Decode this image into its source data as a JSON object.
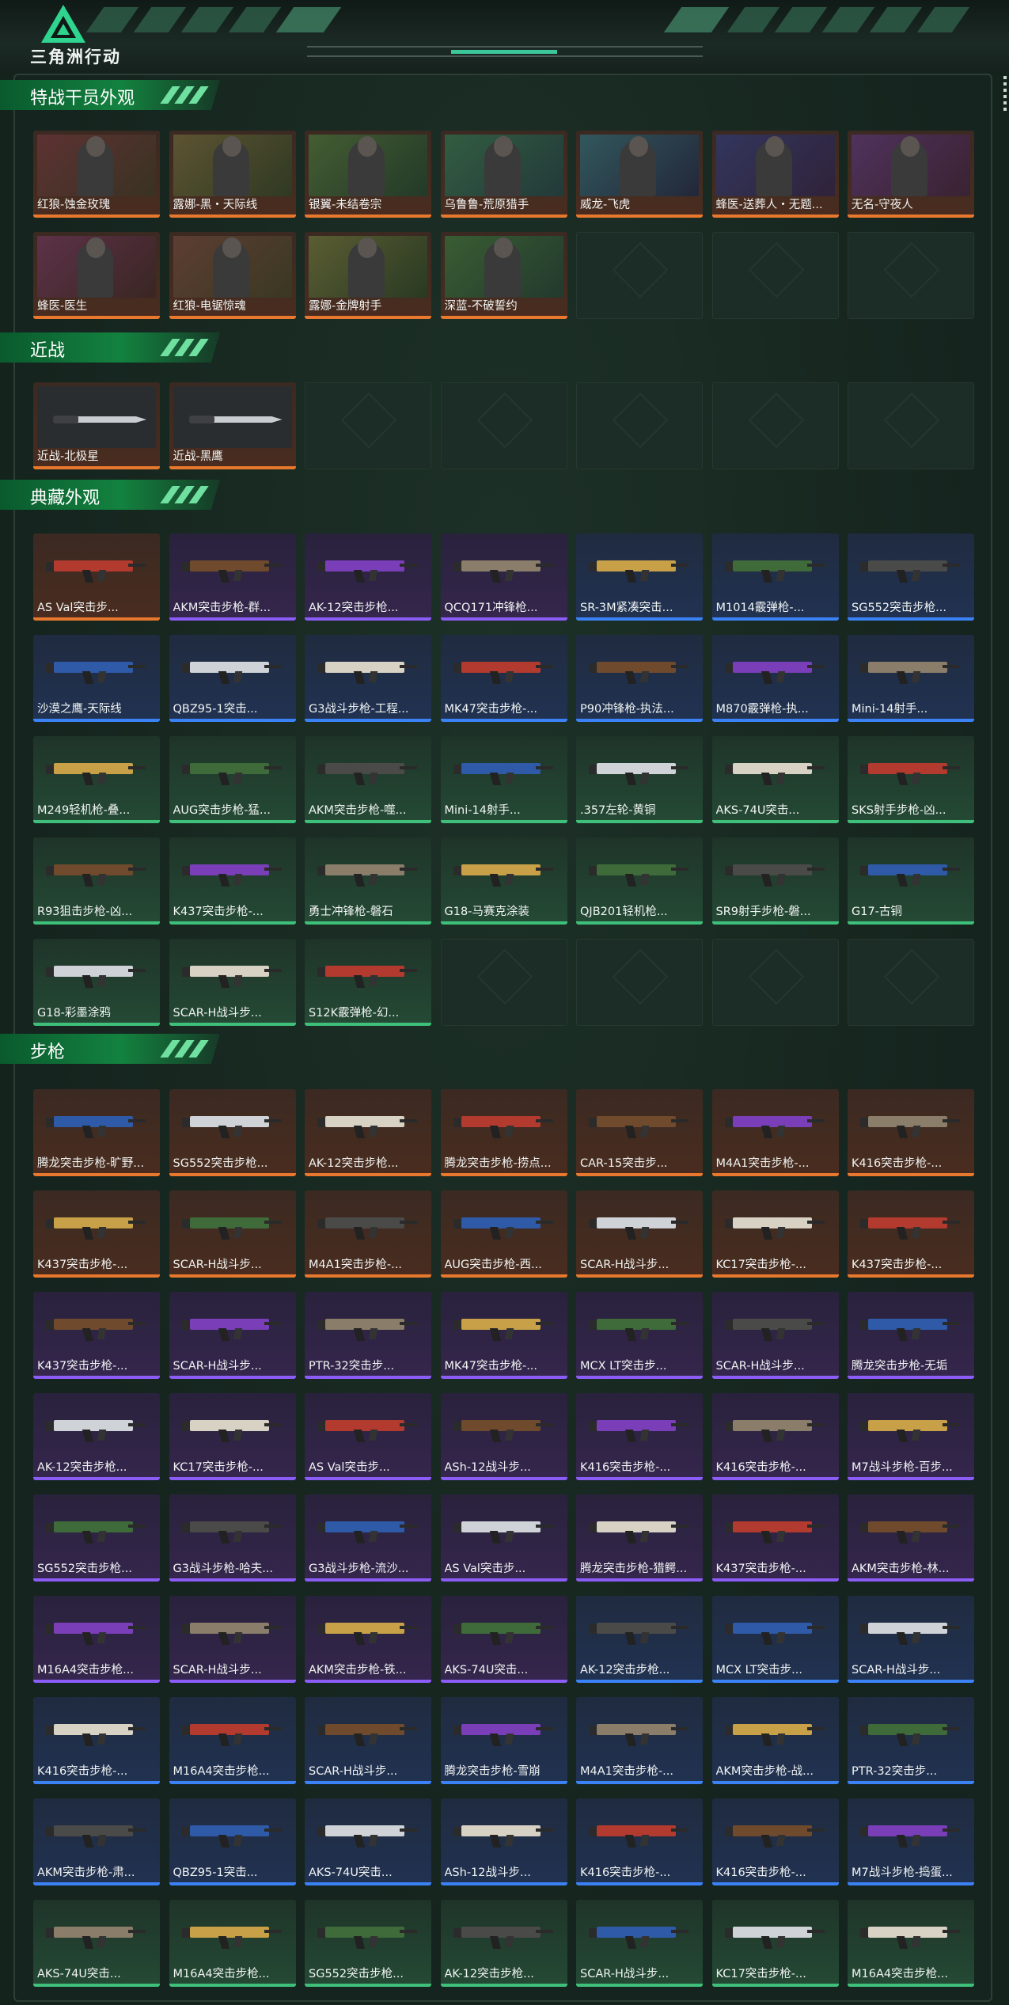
{
  "header": {
    "logo_text": "三角洲行动"
  },
  "sections": [
    {
      "title": "特战干员外观",
      "kind": "operator",
      "rows": 2,
      "items": [
        {
          "label": "红狼-蚀金玫瑰",
          "rarity": "orange"
        },
        {
          "label": "露娜-黑・天际线",
          "rarity": "orange"
        },
        {
          "label": "银翼-未结卷宗",
          "rarity": "orange"
        },
        {
          "label": "乌鲁鲁-荒原猎手",
          "rarity": "orange"
        },
        {
          "label": "威龙-飞虎",
          "rarity": "orange"
        },
        {
          "label": "蜂医-送葬人・无题...",
          "rarity": "orange"
        },
        {
          "label": "无名-守夜人",
          "rarity": "orange"
        },
        {
          "label": "蜂医-医生",
          "rarity": "orange"
        },
        {
          "label": "红狼-电锯惊魂",
          "rarity": "orange"
        },
        {
          "label": "露娜-金牌射手",
          "rarity": "orange"
        },
        {
          "label": "深蓝-不破誓约",
          "rarity": "orange"
        }
      ]
    },
    {
      "title": "近战",
      "kind": "melee",
      "rows": 1,
      "items": [
        {
          "label": "近战-北极星",
          "rarity": "orange"
        },
        {
          "label": "近战-黑鹰",
          "rarity": "orange"
        }
      ]
    },
    {
      "title": "典藏外观",
      "kind": "weapon",
      "rows": 5,
      "items": [
        {
          "label": "AS Val突击步...",
          "rarity": "orange"
        },
        {
          "label": "AKM突击步枪-群...",
          "rarity": "purple"
        },
        {
          "label": "AK-12突击步枪...",
          "rarity": "purple"
        },
        {
          "label": "QCQ171冲锋枪...",
          "rarity": "purple"
        },
        {
          "label": "SR-3M紧凑突击...",
          "rarity": "blue"
        },
        {
          "label": "M1014霰弹枪-...",
          "rarity": "blue"
        },
        {
          "label": "SG552突击步枪...",
          "rarity": "blue"
        },
        {
          "label": "沙漠之鹰-天际线",
          "rarity": "blue"
        },
        {
          "label": "QBZ95-1突击...",
          "rarity": "blue"
        },
        {
          "label": "G3战斗步枪-工程...",
          "rarity": "blue"
        },
        {
          "label": "MK47突击步枪-...",
          "rarity": "blue"
        },
        {
          "label": "P90冲锋枪-执法...",
          "rarity": "blue"
        },
        {
          "label": "M870霰弹枪-执...",
          "rarity": "blue"
        },
        {
          "label": "Mini-14射手...",
          "rarity": "blue"
        },
        {
          "label": "M249轻机枪-叠...",
          "rarity": "green"
        },
        {
          "label": "AUG突击步枪-猛...",
          "rarity": "green"
        },
        {
          "label": "AKM突击步枪-噬...",
          "rarity": "green"
        },
        {
          "label": "Mini-14射手...",
          "rarity": "green"
        },
        {
          "label": ".357左轮-黄铜",
          "rarity": "green"
        },
        {
          "label": "AKS-74U突击...",
          "rarity": "green"
        },
        {
          "label": "SKS射手步枪-凶...",
          "rarity": "green"
        },
        {
          "label": "R93狙击步枪-凶...",
          "rarity": "green"
        },
        {
          "label": "K437突击步枪-...",
          "rarity": "green"
        },
        {
          "label": "勇士冲锋枪-磐石",
          "rarity": "green"
        },
        {
          "label": "G18-马赛克涂装",
          "rarity": "green"
        },
        {
          "label": "QJB201轻机枪...",
          "rarity": "green"
        },
        {
          "label": "SR9射手步枪-磐...",
          "rarity": "green"
        },
        {
          "label": "G17-古铜",
          "rarity": "green"
        },
        {
          "label": "G18-彩墨涂鸦",
          "rarity": "green"
        },
        {
          "label": "SCAR-H战斗步...",
          "rarity": "green"
        },
        {
          "label": "S12K霰弹枪-幻...",
          "rarity": "green"
        }
      ]
    },
    {
      "title": "步枪",
      "kind": "weapon",
      "rows": 9,
      "items": [
        {
          "label": "腾龙突击步枪-旷野...",
          "rarity": "orange"
        },
        {
          "label": "SG552突击步枪...",
          "rarity": "orange"
        },
        {
          "label": "AK-12突击步枪...",
          "rarity": "orange"
        },
        {
          "label": "腾龙突击步枪-捞点...",
          "rarity": "orange"
        },
        {
          "label": "CAR-15突击步...",
          "rarity": "orange"
        },
        {
          "label": "M4A1突击步枪-...",
          "rarity": "orange"
        },
        {
          "label": "K416突击步枪-...",
          "rarity": "orange"
        },
        {
          "label": "K437突击步枪-...",
          "rarity": "orange"
        },
        {
          "label": "SCAR-H战斗步...",
          "rarity": "orange"
        },
        {
          "label": "M4A1突击步枪-...",
          "rarity": "orange"
        },
        {
          "label": "AUG突击步枪-西...",
          "rarity": "orange"
        },
        {
          "label": "SCAR-H战斗步...",
          "rarity": "orange"
        },
        {
          "label": "KC17突击步枪-...",
          "rarity": "orange"
        },
        {
          "label": "K437突击步枪-...",
          "rarity": "orange"
        },
        {
          "label": "K437突击步枪-...",
          "rarity": "purple"
        },
        {
          "label": "SCAR-H战斗步...",
          "rarity": "purple"
        },
        {
          "label": "PTR-32突击步...",
          "rarity": "purple"
        },
        {
          "label": "MK47突击步枪-...",
          "rarity": "purple"
        },
        {
          "label": "MCX LT突击步...",
          "rarity": "purple"
        },
        {
          "label": "SCAR-H战斗步...",
          "rarity": "purple"
        },
        {
          "label": "腾龙突击步枪-无垢",
          "rarity": "purple"
        },
        {
          "label": "AK-12突击步枪...",
          "rarity": "purple"
        },
        {
          "label": "KC17突击步枪-...",
          "rarity": "purple"
        },
        {
          "label": "AS Val突击步...",
          "rarity": "purple"
        },
        {
          "label": "ASh-12战斗步...",
          "rarity": "purple"
        },
        {
          "label": "K416突击步枪-...",
          "rarity": "purple"
        },
        {
          "label": "K416突击步枪-...",
          "rarity": "purple"
        },
        {
          "label": "M7战斗步枪-百步...",
          "rarity": "purple"
        },
        {
          "label": "SG552突击步枪...",
          "rarity": "purple"
        },
        {
          "label": "G3战斗步枪-哈夫...",
          "rarity": "purple"
        },
        {
          "label": "G3战斗步枪-流沙...",
          "rarity": "purple"
        },
        {
          "label": "AS Val突击步...",
          "rarity": "purple"
        },
        {
          "label": "腾龙突击步枪-猎鳄...",
          "rarity": "purple"
        },
        {
          "label": "K437突击步枪-...",
          "rarity": "purple"
        },
        {
          "label": "AKM突击步枪-林...",
          "rarity": "purple"
        },
        {
          "label": "M16A4突击步枪...",
          "rarity": "purple"
        },
        {
          "label": "SCAR-H战斗步...",
          "rarity": "purple"
        },
        {
          "label": "AKM突击步枪-铁...",
          "rarity": "purple"
        },
        {
          "label": "AKS-74U突击...",
          "rarity": "purple"
        },
        {
          "label": "AK-12突击步枪...",
          "rarity": "blue"
        },
        {
          "label": "MCX LT突击步...",
          "rarity": "blue"
        },
        {
          "label": "SCAR-H战斗步...",
          "rarity": "blue"
        },
        {
          "label": "K416突击步枪-...",
          "rarity": "blue"
        },
        {
          "label": "M16A4突击步枪...",
          "rarity": "blue"
        },
        {
          "label": "SCAR-H战斗步...",
          "rarity": "blue"
        },
        {
          "label": "腾龙突击步枪-雪崩",
          "rarity": "blue"
        },
        {
          "label": "M4A1突击步枪-...",
          "rarity": "blue"
        },
        {
          "label": "AKM突击步枪-战...",
          "rarity": "blue"
        },
        {
          "label": "PTR-32突击步...",
          "rarity": "blue"
        },
        {
          "label": "AKM突击步枪-肃...",
          "rarity": "blue"
        },
        {
          "label": "QBZ95-1突击...",
          "rarity": "blue"
        },
        {
          "label": "AKS-74U突击...",
          "rarity": "blue"
        },
        {
          "label": "ASh-12战斗步...",
          "rarity": "blue"
        },
        {
          "label": "K416突击步枪-...",
          "rarity": "blue"
        },
        {
          "label": "K416突击步枪-...",
          "rarity": "blue"
        },
        {
          "label": "M7战斗步枪-捣蛋...",
          "rarity": "blue"
        },
        {
          "label": "AKS-74U突击...",
          "rarity": "green"
        },
        {
          "label": "M16A4突击步枪...",
          "rarity": "green"
        },
        {
          "label": "SG552突击步枪...",
          "rarity": "green"
        },
        {
          "label": "AK-12突击步枪...",
          "rarity": "green"
        },
        {
          "label": "SCAR-H战斗步...",
          "rarity": "green"
        },
        {
          "label": "KC17突击步枪-...",
          "rarity": "green"
        },
        {
          "label": "M16A4突击步枪...",
          "rarity": "green"
        }
      ]
    }
  ],
  "colors": {
    "orange": "#e8782d",
    "purple": "#8b5cf6",
    "blue": "#3b82f6",
    "green": "#3ec07a",
    "accent": "#3cc79a"
  }
}
